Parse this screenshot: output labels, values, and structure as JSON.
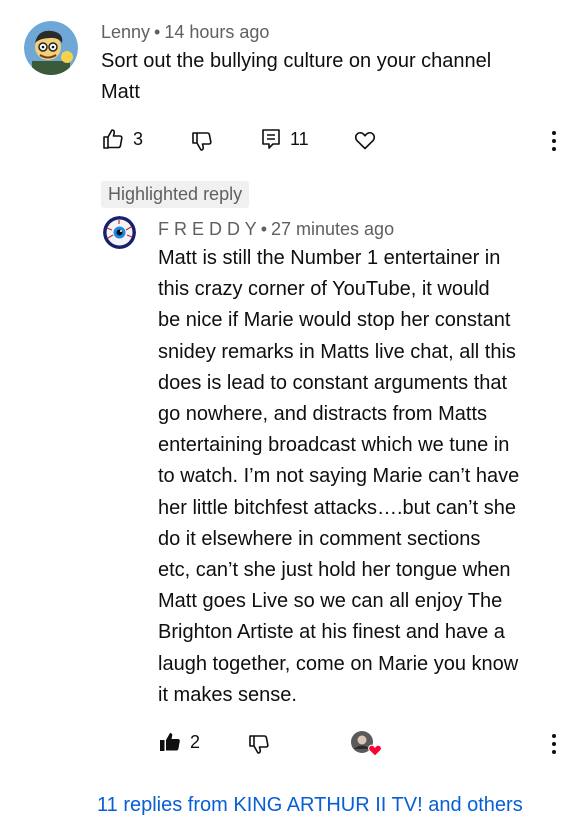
{
  "top_comment": {
    "author": "Lenny",
    "separator": "•",
    "time": "14 hours ago",
    "text_lines": [
      "Sort out the bullying culture on your channel",
      "Matt"
    ],
    "likes": "3",
    "replies_count": "11",
    "icons": [
      "like-icon",
      "dislike-icon",
      "reply-icon",
      "heart-icon",
      "more-icon"
    ]
  },
  "highlight_badge": "Highlighted reply",
  "reply": {
    "author": "F R E D D Y",
    "separator": "•",
    "time": "27 minutes ago",
    "text_lines": [
      "Matt is still the Number 1 entertainer in",
      "this crazy corner of YouTube, it would",
      "be nice if Marie would stop her constant",
      "snidey remarks in Matts live chat, all this",
      "does is lead to constant arguments that",
      "go nowhere, and distracts from Matts",
      "entertaining broadcast which we tune in",
      "to watch. I’m not saying Marie can’t have",
      "her little bitchfest attacks….but can’t she",
      "do it elsewhere in comment sections",
      "etc, can’t she just hold her tongue when",
      "Matt goes Live so we can all enjoy The",
      "Brighton Artiste at his finest and have a",
      "laugh together, come on Marie you know",
      "it makes sense."
    ],
    "likes": "2",
    "icons": [
      "like-filled-icon",
      "dislike-icon",
      "creator-heart-icon",
      "more-icon"
    ]
  },
  "view_replies": "11 replies from KING ARTHUR II TV! and others",
  "colors": {
    "link": "#065fd4",
    "meta": "#606060",
    "heart": "#ff0033"
  }
}
